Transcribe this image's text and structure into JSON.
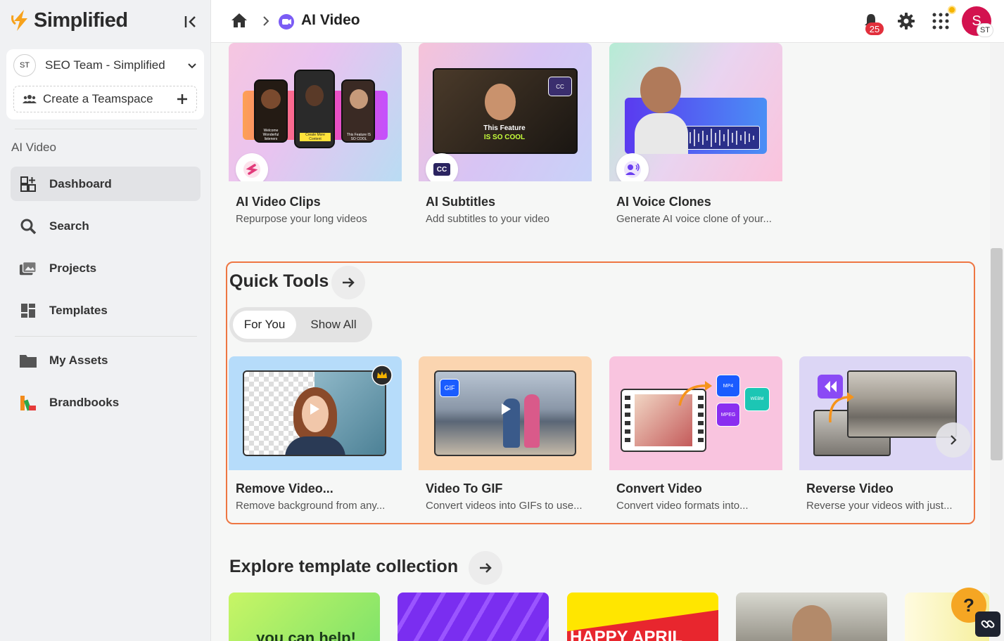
{
  "app": {
    "brand": "Simplified"
  },
  "sidebar": {
    "team": {
      "initials": "ST",
      "name": "SEO Team - Simplified"
    },
    "create_teamspace": "Create a Teamspace",
    "section_label": "AI Video",
    "items": [
      {
        "label": "Dashboard",
        "icon": "dashboard-icon",
        "active": true
      },
      {
        "label": "Search",
        "icon": "search-icon"
      },
      {
        "label": "Projects",
        "icon": "projects-icon"
      },
      {
        "label": "Templates",
        "icon": "templates-icon"
      },
      {
        "label": "My Assets",
        "icon": "folder-icon"
      },
      {
        "label": "Brandbooks",
        "icon": "brandbooks-icon"
      }
    ]
  },
  "header": {
    "breadcrumb_title": "AI Video",
    "notifications_count": "25",
    "avatar_letter": "S",
    "avatar_initials": "ST"
  },
  "features": [
    {
      "title": "AI Video Clips",
      "subtitle": "Repurpose your long videos",
      "thumb_text": [
        "Welcome Wonderful listeners",
        "Create More Content",
        "This Feature IS SO COOL"
      ]
    },
    {
      "title": "AI Subtitles",
      "subtitle": "Add subtitles to your video",
      "thumb_text": [
        "This Feature",
        "IS SO COOL",
        "CC"
      ]
    },
    {
      "title": "AI Voice Clones",
      "subtitle": "Generate AI voice clone of your..."
    }
  ],
  "quick_tools": {
    "title": "Quick Tools",
    "tabs": [
      {
        "label": "For You",
        "active": true
      },
      {
        "label": "Show All",
        "active": false
      }
    ],
    "cards": [
      {
        "title": "Remove Video...",
        "subtitle": "Remove background from any..."
      },
      {
        "title": "Video To GIF",
        "subtitle": "Convert videos into GIFs to use...",
        "thumb_text": "GIF"
      },
      {
        "title": "Convert Video",
        "subtitle": "Convert video formats into...",
        "thumb_text": [
          "MP4",
          "WEBM",
          "MPEG"
        ]
      },
      {
        "title": "Reverse Video",
        "subtitle": "Reverse your videos with just..."
      }
    ]
  },
  "explore": {
    "title": "Explore template collection",
    "thumb_text": [
      "you can help!",
      "HAPPY APRIL"
    ]
  },
  "help_label": "?",
  "colors": {
    "accent": "#ee7642",
    "badge": "#e22f3c",
    "avatar": "#d3124f",
    "help": "#f5a623"
  }
}
